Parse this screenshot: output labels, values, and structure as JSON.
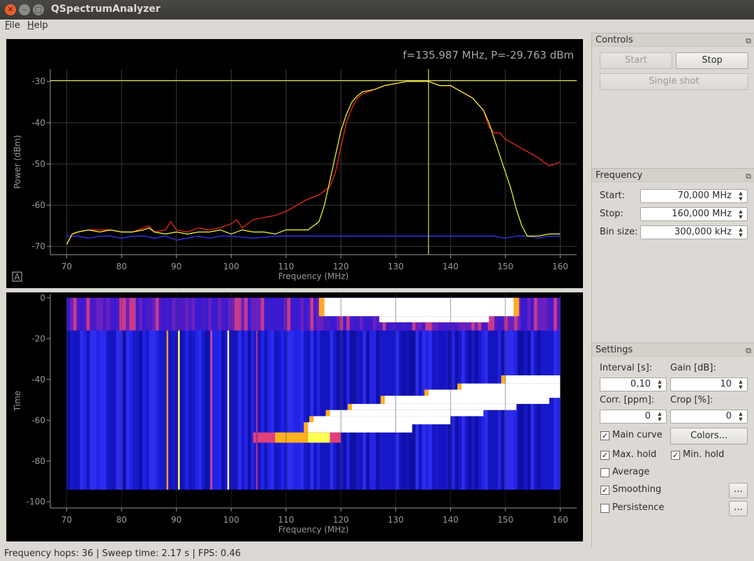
{
  "window": {
    "title": "QSpectrumAnalyzer",
    "close_glyph": "✕",
    "min_glyph": "–",
    "max_glyph": "□"
  },
  "menu": [
    {
      "accel": "F",
      "rest": "ile"
    },
    {
      "accel": "H",
      "rest": "elp"
    }
  ],
  "spectrum": {
    "readout": "f=135.987 MHz, P=-29.763 dBm",
    "xlabel": "Frequency (MHz)",
    "ylabel": "Power (dBm)",
    "auto_button": "A",
    "xticks": [
      "70",
      "80",
      "90",
      "100",
      "110",
      "120",
      "130",
      "140",
      "150",
      "160"
    ],
    "yticks": [
      "-30",
      "-40",
      "-50",
      "-60",
      "-70"
    ]
  },
  "waterfall": {
    "xlabel": "Frequency (MHz)",
    "ylabel": "Time",
    "xticks": [
      "70",
      "80",
      "90",
      "100",
      "110",
      "120",
      "130",
      "140",
      "150",
      "160"
    ],
    "yticks": [
      "0",
      "-20",
      "-40",
      "-60",
      "-80",
      "-100"
    ]
  },
  "controls": {
    "title": "Controls",
    "start": "Start",
    "stop": "Stop",
    "single_shot": "Single shot"
  },
  "frequency": {
    "title": "Frequency",
    "start_label": "Start:",
    "start_value": "70,000 MHz",
    "stop_label": "Stop:",
    "stop_value": "160,000 MHz",
    "bin_label": "Bin size:",
    "bin_value": "300,000 kHz"
  },
  "settings": {
    "title": "Settings",
    "interval_label": "Interval [s]:",
    "interval_value": "0,10",
    "gain_label": "Gain [dB]:",
    "gain_value": "10",
    "corr_label": "Corr. [ppm]:",
    "corr_value": "0",
    "crop_label": "Crop [%]:",
    "crop_value": "0",
    "main_curve": "Main curve",
    "colors_button": "Colors...",
    "max_hold": "Max. hold",
    "min_hold": "Min. hold",
    "average": "Average",
    "smoothing": "Smoothing",
    "persistence": "Persistence",
    "more": "...",
    "check_glyph": "✓",
    "checked": {
      "main_curve": true,
      "max_hold": true,
      "min_hold": true,
      "average": false,
      "smoothing": true,
      "persistence": false
    }
  },
  "status": "Frequency hops: 36 | Sweep time: 2.17 s | FPS: 0.46",
  "chart_data": [
    {
      "type": "line",
      "x_unit": "MHz",
      "xlabel": "Frequency (MHz)",
      "ylabel": "Power (dBm)",
      "xlim": [
        67,
        163
      ],
      "ylim": [
        -72,
        -27
      ],
      "grid": true,
      "marker": {
        "frequency_mhz": 135.987,
        "power_dbm": -29.763
      },
      "series": [
        {
          "color": "#ffff33",
          "x": [
            70,
            71,
            72,
            74,
            76,
            78,
            80,
            82,
            84,
            85,
            86,
            88,
            90,
            92,
            94,
            96,
            98,
            100,
            102,
            104,
            106,
            108,
            110,
            112,
            114,
            116,
            117,
            118,
            119,
            120,
            121,
            122,
            123,
            124,
            126,
            128,
            130,
            132,
            134,
            136,
            138,
            140,
            142,
            144,
            146,
            147,
            148,
            149,
            150,
            151,
            152,
            153,
            154,
            156,
            158,
            160
          ],
          "y": [
            -69.5,
            -67,
            -66.5,
            -66,
            -66.5,
            -66,
            -66.5,
            -66.5,
            -66,
            -65.5,
            -66.5,
            -67,
            -66.5,
            -67,
            -66.5,
            -66.5,
            -66,
            -67,
            -66,
            -66.5,
            -66.5,
            -67,
            -66,
            -66,
            -66,
            -64,
            -60,
            -54,
            -48,
            -42,
            -38,
            -35,
            -33.5,
            -32.5,
            -32,
            -31,
            -30.5,
            -30,
            -30,
            -30,
            -31,
            -31,
            -32.5,
            -34,
            -37,
            -40,
            -44,
            -48,
            -52,
            -56,
            -61,
            -65,
            -67.5,
            -67.5,
            -67,
            -67
          ]
        },
        {
          "color": "#ff2a1a",
          "x": [
            70,
            71,
            72,
            74,
            76,
            78,
            80,
            82,
            84,
            85,
            86,
            88,
            89,
            90,
            92,
            94,
            96,
            98,
            100,
            101,
            102,
            104,
            106,
            108,
            110,
            112,
            114,
            116,
            118,
            119,
            120,
            121,
            122,
            123,
            124,
            126,
            128,
            130,
            132,
            134,
            136,
            138,
            140,
            142,
            144,
            146,
            147,
            148,
            149,
            150,
            152,
            154,
            156,
            158,
            160
          ],
          "y": [
            -69.5,
            -67,
            -66.5,
            -66,
            -66,
            -66,
            -66.5,
            -66.5,
            -65.5,
            -65,
            -66.5,
            -66,
            -64,
            -66,
            -66.5,
            -65.5,
            -66,
            -65.5,
            -64.5,
            -63.5,
            -65.5,
            -63.5,
            -63,
            -62.5,
            -61.5,
            -60,
            -58.5,
            -57.5,
            -55.5,
            -52,
            -46,
            -40,
            -36.5,
            -34,
            -33,
            -32,
            -31,
            -30.5,
            -30,
            -30,
            -30,
            -31,
            -31,
            -32.5,
            -34,
            -37,
            -41,
            -42.5,
            -42.5,
            -44,
            -45.5,
            -47,
            -48.5,
            -50.5,
            -49.5
          ]
        },
        {
          "color": "#3a3aff",
          "x": [
            70,
            72,
            74,
            76,
            78,
            80,
            82,
            84,
            86,
            88,
            90,
            92,
            94,
            96,
            98,
            100,
            104,
            108,
            112,
            116,
            120,
            124,
            128,
            132,
            136,
            140,
            144,
            148,
            150,
            152,
            154,
            156,
            158,
            160
          ],
          "y": [
            -67.5,
            -67.5,
            -68,
            -67.5,
            -67.5,
            -68,
            -67.5,
            -67.5,
            -68,
            -67.5,
            -68.5,
            -68,
            -67.5,
            -68,
            -67.5,
            -67.5,
            -68,
            -67.5,
            -67.5,
            -67.5,
            -67.5,
            -67.5,
            -67.5,
            -67.5,
            -67.5,
            -67.5,
            -67.5,
            -67.5,
            -68,
            -67.5,
            -67.5,
            -68,
            -67.5,
            -67.5
          ]
        }
      ]
    },
    {
      "type": "heatmap",
      "x_unit": "MHz",
      "xlabel": "Frequency (MHz)",
      "ylabel": "Time",
      "xlim": [
        67,
        163
      ],
      "ylim": [
        -103,
        2
      ],
      "data_x_range": [
        70,
        160
      ],
      "data_y_range": [
        -94,
        0
      ],
      "colormap": [
        "#1a1ad8",
        "#6a1ab0",
        "#d81a6a",
        "#ff8a1a",
        "#ffff33",
        "#ffffff"
      ]
    }
  ]
}
